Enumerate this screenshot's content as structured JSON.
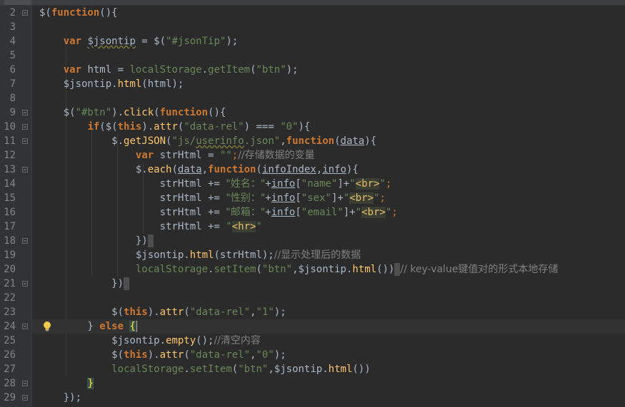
{
  "window": {
    "title": ""
  },
  "editor": {
    "current_line": "24",
    "lines": [
      {
        "num": "2",
        "parts": [
          {
            "t": "$(",
            "c": ""
          },
          {
            "t": "function",
            "c": "kw"
          },
          {
            "t": "(){",
            "c": ""
          }
        ]
      },
      {
        "num": "3",
        "parts": []
      },
      {
        "num": "4",
        "parts": [
          {
            "t": "    ",
            "c": ""
          },
          {
            "t": "var ",
            "c": "kw"
          },
          {
            "t": "$jsontip",
            "c": "wavy"
          },
          {
            "t": " = $(",
            "c": ""
          },
          {
            "t": "\"#jsonTip\"",
            "c": "str"
          },
          {
            "t": ");",
            "c": ""
          }
        ]
      },
      {
        "num": "5",
        "parts": []
      },
      {
        "num": "6",
        "parts": [
          {
            "t": "    ",
            "c": ""
          },
          {
            "t": "var ",
            "c": "kw"
          },
          {
            "t": "html = ",
            "c": ""
          },
          {
            "t": "localStorage",
            "c": "str"
          },
          {
            "t": ".",
            "c": ""
          },
          {
            "t": "getItem",
            "c": "str"
          },
          {
            "t": "(",
            "c": ""
          },
          {
            "t": "\"btn\"",
            "c": "str"
          },
          {
            "t": ");",
            "c": ""
          }
        ]
      },
      {
        "num": "7",
        "parts": [
          {
            "t": "    $jsontip.",
            "c": ""
          },
          {
            "t": "html",
            "c": "fn"
          },
          {
            "t": "(html);",
            "c": ""
          }
        ]
      },
      {
        "num": "8",
        "parts": []
      },
      {
        "num": "9",
        "parts": [
          {
            "t": "    $(",
            "c": ""
          },
          {
            "t": "\"#btn\"",
            "c": "str"
          },
          {
            "t": ").",
            "c": ""
          },
          {
            "t": "click",
            "c": "fn"
          },
          {
            "t": "(",
            "c": ""
          },
          {
            "t": "function",
            "c": "kw"
          },
          {
            "t": "(){",
            "c": ""
          }
        ]
      },
      {
        "num": "10",
        "parts": [
          {
            "t": "        ",
            "c": ""
          },
          {
            "t": "if",
            "c": "kw"
          },
          {
            "t": "($(",
            "c": ""
          },
          {
            "t": "this",
            "c": "kw"
          },
          {
            "t": ").",
            "c": ""
          },
          {
            "t": "attr",
            "c": "fn"
          },
          {
            "t": "(",
            "c": ""
          },
          {
            "t": "\"data-rel\"",
            "c": "str"
          },
          {
            "t": ") === ",
            "c": ""
          },
          {
            "t": "\"0\"",
            "c": "str"
          },
          {
            "t": "){",
            "c": ""
          }
        ]
      },
      {
        "num": "11",
        "parts": [
          {
            "t": "            $.",
            "c": ""
          },
          {
            "t": "getJSON",
            "c": "fn"
          },
          {
            "t": "(",
            "c": ""
          },
          {
            "t": "\"js/",
            "c": "str"
          },
          {
            "t": "userinfo",
            "c": "str wavy"
          },
          {
            "t": ".json\"",
            "c": "str"
          },
          {
            "t": ",",
            "c": ""
          },
          {
            "t": "function",
            "c": "kw"
          },
          {
            "t": "(",
            "c": ""
          },
          {
            "t": "data",
            "c": "ul"
          },
          {
            "t": "){",
            "c": ""
          }
        ]
      },
      {
        "num": "12",
        "parts": [
          {
            "t": "                ",
            "c": ""
          },
          {
            "t": "var ",
            "c": "kw"
          },
          {
            "t": "strHtml = ",
            "c": ""
          },
          {
            "t": "\"\"",
            "c": "str"
          },
          {
            "t": ";",
            "c": "kwn"
          },
          {
            "t": "//存储数据的变量",
            "c": "cm-zh"
          }
        ]
      },
      {
        "num": "13",
        "parts": [
          {
            "t": "                $.",
            "c": ""
          },
          {
            "t": "each",
            "c": "fn"
          },
          {
            "t": "(",
            "c": ""
          },
          {
            "t": "data",
            "c": "ul"
          },
          {
            "t": ",",
            "c": ""
          },
          {
            "t": "function",
            "c": "kw"
          },
          {
            "t": "(",
            "c": ""
          },
          {
            "t": "infoIndex",
            "c": "ul"
          },
          {
            "t": ",",
            "c": ""
          },
          {
            "t": "info",
            "c": "ul"
          },
          {
            "t": "){",
            "c": ""
          }
        ]
      },
      {
        "num": "14",
        "parts": [
          {
            "t": "                    strHtml += ",
            "c": ""
          },
          {
            "t": "\"姓名：\"",
            "c": "str-zh"
          },
          {
            "t": "+",
            "c": ""
          },
          {
            "t": "info",
            "c": "ul"
          },
          {
            "t": "[",
            "c": ""
          },
          {
            "t": "\"name\"",
            "c": "str"
          },
          {
            "t": "]+",
            "c": ""
          },
          {
            "t": "\"",
            "c": "str"
          },
          {
            "t": "<br>",
            "c": "tag"
          },
          {
            "t": "\"",
            "c": "str"
          },
          {
            "t": ";",
            "c": "kwn"
          }
        ]
      },
      {
        "num": "15",
        "parts": [
          {
            "t": "                    strHtml += ",
            "c": ""
          },
          {
            "t": "\"性别：\"",
            "c": "str-zh"
          },
          {
            "t": "+",
            "c": ""
          },
          {
            "t": "info",
            "c": "ul"
          },
          {
            "t": "[",
            "c": ""
          },
          {
            "t": "\"sex\"",
            "c": "str"
          },
          {
            "t": "]+",
            "c": ""
          },
          {
            "t": "\"",
            "c": "str"
          },
          {
            "t": "<br>",
            "c": "tag"
          },
          {
            "t": "\"",
            "c": "str"
          },
          {
            "t": ";",
            "c": "kwn"
          }
        ]
      },
      {
        "num": "16",
        "parts": [
          {
            "t": "                    strHtml += ",
            "c": ""
          },
          {
            "t": "\"邮箱：\"",
            "c": "str-zh"
          },
          {
            "t": "+",
            "c": ""
          },
          {
            "t": "info",
            "c": "ul"
          },
          {
            "t": "[",
            "c": ""
          },
          {
            "t": "\"email\"",
            "c": "str"
          },
          {
            "t": "]+",
            "c": ""
          },
          {
            "t": "\"",
            "c": "str"
          },
          {
            "t": "<br>",
            "c": "tag"
          },
          {
            "t": "\"",
            "c": "str"
          },
          {
            "t": ";",
            "c": "kwn"
          }
        ]
      },
      {
        "num": "17",
        "parts": [
          {
            "t": "                    strHtml += ",
            "c": ""
          },
          {
            "t": "\"",
            "c": "str"
          },
          {
            "t": "<hr>",
            "c": "tag"
          },
          {
            "t": "\"",
            "c": "str"
          }
        ]
      },
      {
        "num": "18",
        "parts": [
          {
            "t": "                })",
            "c": ""
          },
          {
            "t": "",
            "c": "tailbox"
          }
        ]
      },
      {
        "num": "19",
        "parts": [
          {
            "t": "                $jsontip.",
            "c": ""
          },
          {
            "t": "html",
            "c": "fn"
          },
          {
            "t": "(strHtml);",
            "c": ""
          },
          {
            "t": "//显示处理后的数据",
            "c": "cm-zh"
          }
        ]
      },
      {
        "num": "20",
        "parts": [
          {
            "t": "                ",
            "c": ""
          },
          {
            "t": "localStorage",
            "c": "str"
          },
          {
            "t": ".",
            "c": ""
          },
          {
            "t": "setItem",
            "c": "str"
          },
          {
            "t": "(",
            "c": ""
          },
          {
            "t": "\"btn\"",
            "c": "str"
          },
          {
            "t": ",$jsontip.",
            "c": ""
          },
          {
            "t": "html",
            "c": "fn"
          },
          {
            "t": "())",
            "c": ""
          },
          {
            "t": "",
            "c": "tailbox"
          },
          {
            "t": "// key-value键值对的形式本地存储",
            "c": "cm-zh"
          }
        ]
      },
      {
        "num": "21",
        "parts": [
          {
            "t": "            })",
            "c": ""
          },
          {
            "t": "",
            "c": "tailbox"
          }
        ]
      },
      {
        "num": "22",
        "parts": []
      },
      {
        "num": "23",
        "parts": [
          {
            "t": "            $(",
            "c": ""
          },
          {
            "t": "this",
            "c": "kw"
          },
          {
            "t": ").",
            "c": ""
          },
          {
            "t": "attr",
            "c": "fn"
          },
          {
            "t": "(",
            "c": ""
          },
          {
            "t": "\"data-rel\"",
            "c": "str"
          },
          {
            "t": ",",
            "c": ""
          },
          {
            "t": "\"1\"",
            "c": "str"
          },
          {
            "t": ");",
            "c": ""
          }
        ]
      },
      {
        "num": "24",
        "parts": [
          {
            "t": "        } ",
            "c": ""
          },
          {
            "t": "else",
            "c": "kw"
          },
          {
            "t": " ",
            "c": ""
          },
          {
            "t": "{",
            "c": "brace-hl"
          },
          {
            "t": "",
            "c": "caret"
          }
        ]
      },
      {
        "num": "25",
        "parts": [
          {
            "t": "            $jsontip.",
            "c": ""
          },
          {
            "t": "empty",
            "c": "fn"
          },
          {
            "t": "();",
            "c": ""
          },
          {
            "t": "//清空内容",
            "c": "cm-zh"
          }
        ]
      },
      {
        "num": "26",
        "parts": [
          {
            "t": "            $(",
            "c": ""
          },
          {
            "t": "this",
            "c": "kw"
          },
          {
            "t": ").",
            "c": ""
          },
          {
            "t": "attr",
            "c": "fn"
          },
          {
            "t": "(",
            "c": ""
          },
          {
            "t": "\"data-rel\"",
            "c": "str"
          },
          {
            "t": ",",
            "c": ""
          },
          {
            "t": "\"0\"",
            "c": "str"
          },
          {
            "t": ");",
            "c": ""
          }
        ]
      },
      {
        "num": "27",
        "parts": [
          {
            "t": "            ",
            "c": ""
          },
          {
            "t": "localStorage",
            "c": "str"
          },
          {
            "t": ".",
            "c": ""
          },
          {
            "t": "setItem",
            "c": "str"
          },
          {
            "t": "(",
            "c": ""
          },
          {
            "t": "\"btn\"",
            "c": "str"
          },
          {
            "t": ",$jsontip.",
            "c": ""
          },
          {
            "t": "html",
            "c": "fn"
          },
          {
            "t": "())",
            "c": ""
          }
        ]
      },
      {
        "num": "28",
        "parts": [
          {
            "t": "        ",
            "c": ""
          },
          {
            "t": "}",
            "c": "brace-hl"
          }
        ]
      },
      {
        "num": "29",
        "parts": [
          {
            "t": "    });",
            "c": ""
          }
        ]
      }
    ],
    "fold_markers": [
      "2",
      "9",
      "10",
      "11",
      "13",
      "18",
      "21",
      "24",
      "28",
      "29"
    ],
    "intention_icon": "lightbulb-icon",
    "colors": {
      "background": "#2b2b2b",
      "gutter": "#313335",
      "keyword": "#cc7832",
      "string": "#6a8759",
      "function": "#ffc66d",
      "comment": "#808080",
      "text": "#a9b7c6"
    }
  }
}
